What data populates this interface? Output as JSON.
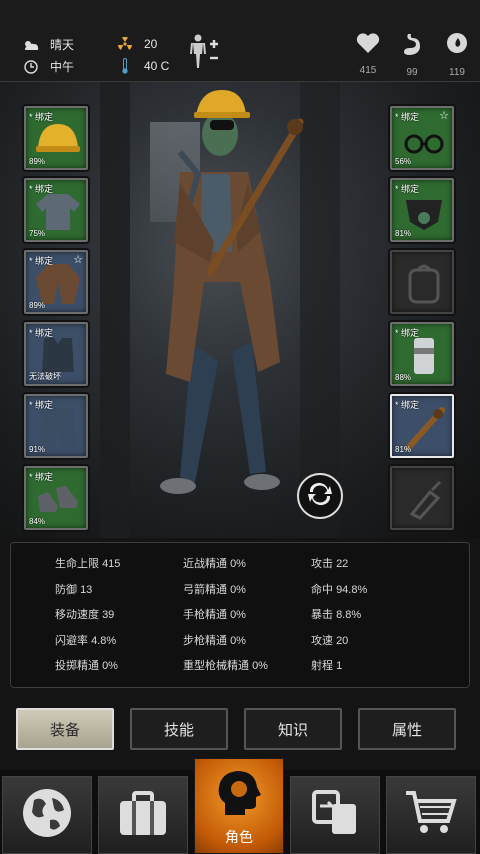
{
  "status": {
    "weather": "晴天",
    "time": "中午",
    "radiation": "20",
    "temperature": "40 C",
    "health": "415",
    "hunger": "99",
    "thirst": "119"
  },
  "slots": {
    "tag": "* 绑定",
    "left": [
      {
        "pct": "89%"
      },
      {
        "pct": "75%"
      },
      {
        "pct": "89%"
      },
      {
        "pct": "无法破坏"
      },
      {
        "pct": "91%"
      },
      {
        "pct": "84%"
      }
    ],
    "right": [
      {
        "pct": "56%"
      },
      {
        "pct": "81%"
      },
      {
        "pct": ""
      },
      {
        "pct": "88%"
      },
      {
        "pct": "81%"
      },
      {
        "pct": ""
      }
    ]
  },
  "stats": [
    {
      "label": "生命上限",
      "value": "415"
    },
    {
      "label": "防御",
      "value": "13"
    },
    {
      "label": "移动速度",
      "value": "39"
    },
    {
      "label": "闪避率",
      "value": "4.8%"
    },
    {
      "label": "投掷精通",
      "value": "0%"
    },
    {
      "label": "近战精通",
      "value": "0%"
    },
    {
      "label": "弓箭精通",
      "value": "0%"
    },
    {
      "label": "手枪精通",
      "value": "0%"
    },
    {
      "label": "步枪精通",
      "value": "0%"
    },
    {
      "label": "重型枪械精通",
      "value": "0%"
    },
    {
      "label": "攻击",
      "value": "22"
    },
    {
      "label": "命中",
      "value": "94.8%"
    },
    {
      "label": "暴击",
      "value": "8.8%"
    },
    {
      "label": "攻速",
      "value": "20"
    },
    {
      "label": "射程",
      "value": "1"
    }
  ],
  "tabs": [
    "装备",
    "技能",
    "知识",
    "属性"
  ],
  "nav": {
    "character": "角色"
  },
  "icons": [
    "sun-cloud-icon",
    "clock-icon",
    "radiation-icon",
    "thermometer-icon",
    "body-status-icon",
    "heart-icon",
    "stomach-icon",
    "water-drop-icon",
    "swap-icon",
    "globe-icon",
    "backpack-icon",
    "character-head-icon",
    "trade-icon",
    "cart-icon"
  ]
}
